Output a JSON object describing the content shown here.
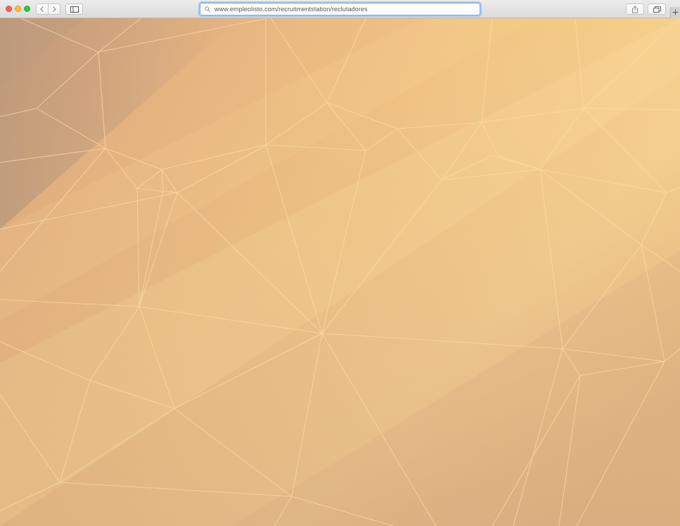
{
  "browser": {
    "address_bar": {
      "url": "www.empleolisto.com/recruitmentstation/reclutadores"
    }
  },
  "icons": {
    "back": "chevron-left-icon",
    "forward": "chevron-right-icon",
    "sidebar": "sidebar-icon",
    "search": "search-icon",
    "share": "share-icon",
    "tabs": "tab-overview-icon",
    "new_tab": "plus-icon"
  },
  "colors": {
    "background_light": "#f7d08e",
    "background_mid": "#e8b982",
    "background_dark": "#c9a07c",
    "mesh_lines": "#fbdca4",
    "address_focus": "#7aa7e5"
  }
}
